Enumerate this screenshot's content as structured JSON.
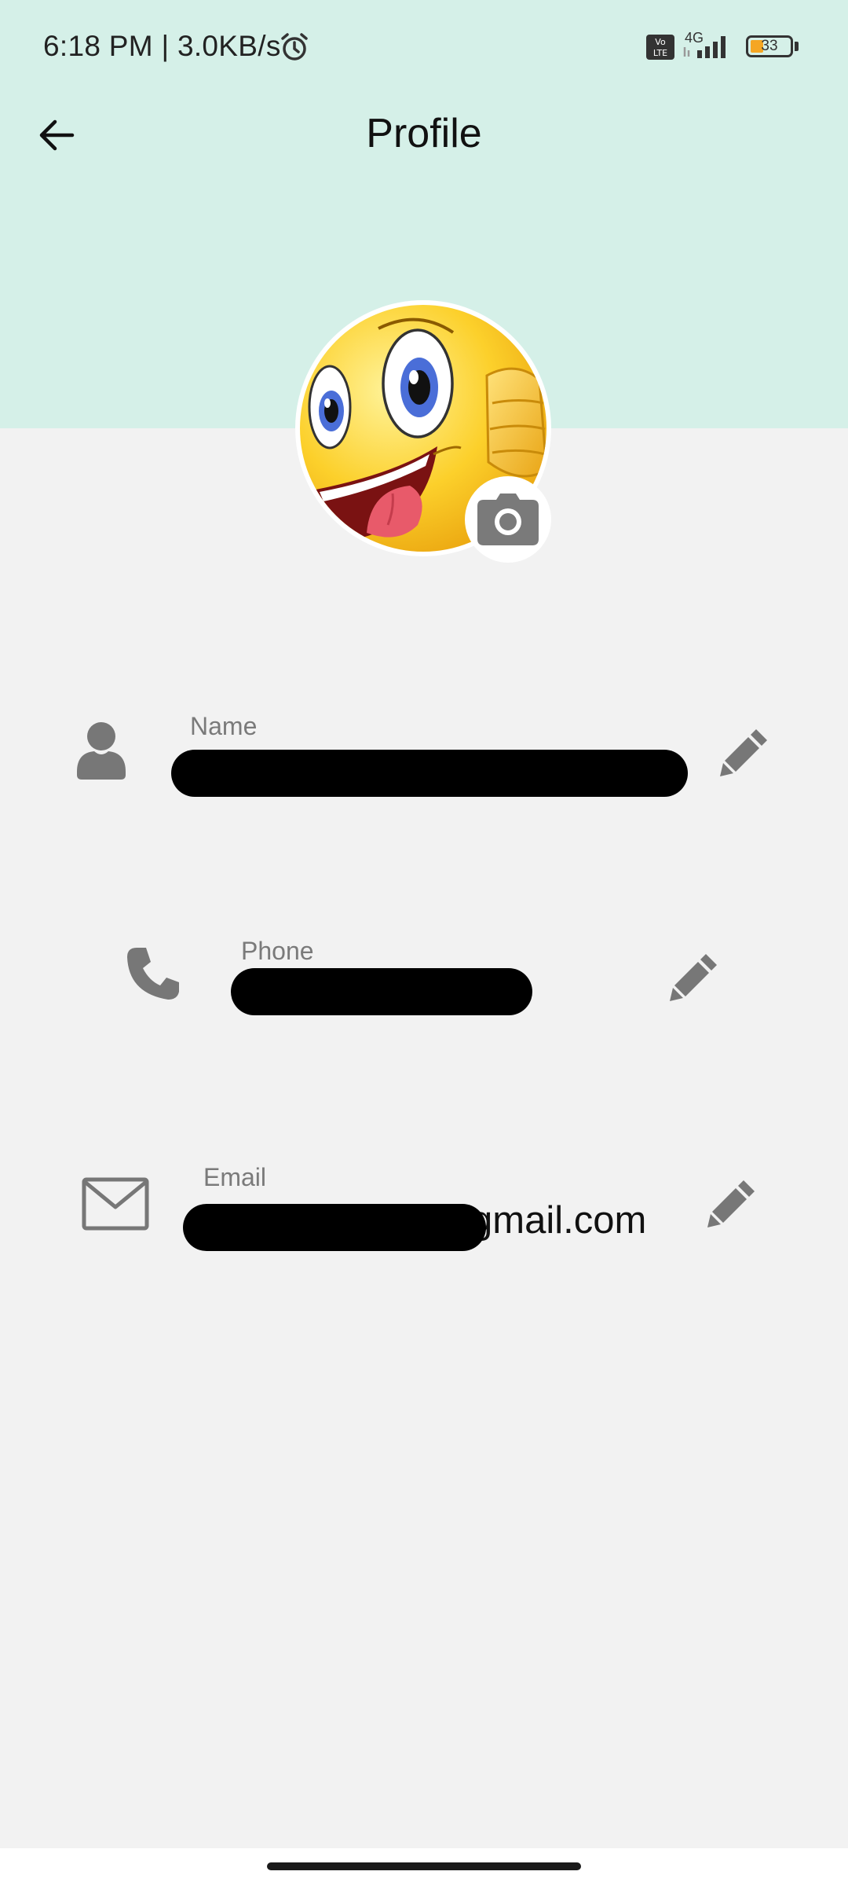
{
  "status_bar": {
    "time": "6:18 PM | 3.0KB/s",
    "network": "4G",
    "battery": "33",
    "battery_level_percent": 33
  },
  "app_bar": {
    "title": "Profile",
    "back_icon": "arrow-left-icon"
  },
  "avatar": {
    "image": "emoji-thumbs-up-avatar",
    "camera_icon": "camera-icon"
  },
  "fields": {
    "name": {
      "label": "Name",
      "icon": "person-icon",
      "edit_icon": "pencil-icon"
    },
    "phone": {
      "label": "Phone",
      "icon": "phone-icon",
      "edit_icon": "pencil-icon"
    },
    "email": {
      "label": "Email",
      "value_suffix": "gmail.com",
      "icon": "envelope-icon",
      "edit_icon": "pencil-icon"
    }
  },
  "colors": {
    "header_bg": "#d5f0e8",
    "body_bg": "#f2f2f2",
    "icon_gray": "#777777",
    "battery_fill": "#f5a623"
  }
}
